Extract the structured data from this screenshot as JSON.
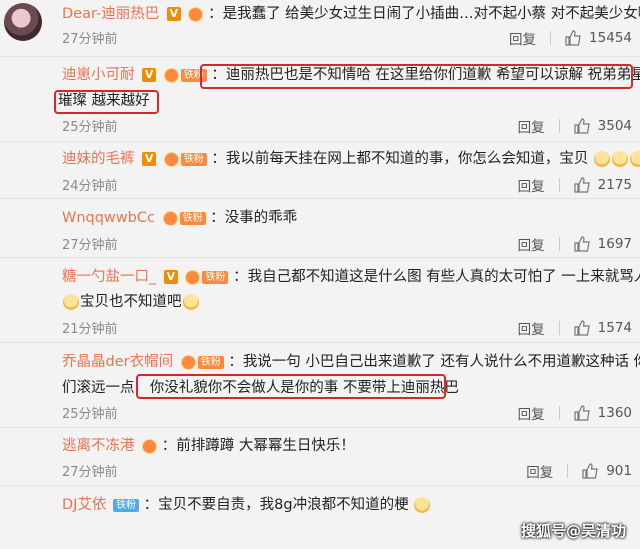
{
  "comments": [
    {
      "user": "Dear-迪丽热巴",
      "text": "是我蠢了 给美少女过生日闹了小插曲…对不起小蔡 对不起美少女啊…",
      "time": "27分钟前",
      "reply": "回复",
      "likes": "15454"
    },
    {
      "user": "迪崽小可耐",
      "text1": "迪丽热巴也是不知情哈 在这里给你们道歉 希望可以谅解 祝弟弟星途",
      "text2": "璀璨 越来越好",
      "time": "25分钟前",
      "reply": "回复",
      "likes": "3504",
      "badge": "铁粉"
    },
    {
      "user": "迪妹的毛裤",
      "text": "我以前每天挂在网上都不知道的事，你怎么会知道，宝贝",
      "time": "24分钟前",
      "reply": "回复",
      "likes": "2175",
      "badge": "铁粉"
    },
    {
      "user": "WnqqwwbCc",
      "text": "没事的乖乖",
      "time": "27分钟前",
      "reply": "回复",
      "likes": "1697",
      "badge": "铁粉"
    },
    {
      "user": "糖一勺盐一口_",
      "text1": "我自己都不知道这是什么图 有些人真的太可怕了 一上来就骂人",
      "text2": "宝贝也不知道吧",
      "time": "21分钟前",
      "reply": "回复",
      "likes": "1574",
      "badge": "铁粉"
    },
    {
      "user": "乔晶晶der衣帽间",
      "text1": "我说一句  小巴自己出来道歉了  还有人说什么不用道歉这种话  你",
      "text2a": "们滚远一点",
      "text2b": "你没礼貌你不会做人是你的事  不要带上迪丽热巴",
      "time": "25分钟前",
      "reply": "回复",
      "likes": "1360",
      "badge": "铁粉"
    },
    {
      "user": "逃离不冻港",
      "text": "前排蹲蹲 大幂幂生日快乐！",
      "time": "27分钟前",
      "reply": "回复",
      "likes": "901"
    },
    {
      "user": "DJ艾依",
      "text": "宝贝不要自责，我8g冲浪都不知道的梗",
      "badge": "铁粉"
    }
  ],
  "watermark": "搜狐号@吴清功"
}
